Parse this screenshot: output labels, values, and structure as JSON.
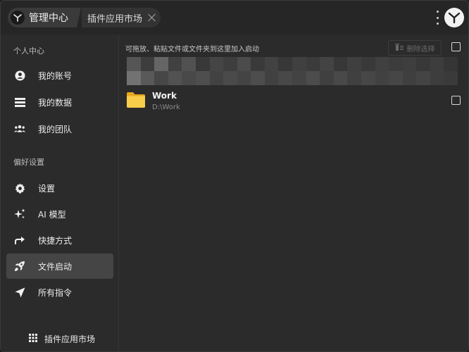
{
  "titlebar": {
    "home_label": "管理中心",
    "current_tab": "插件应用市场"
  },
  "sidebar": {
    "section_personal": "个人中心",
    "section_prefs": "偏好设置",
    "items": [
      {
        "label": "我的账号",
        "icon": "user-circle-icon"
      },
      {
        "label": "我的数据",
        "icon": "data-list-icon"
      },
      {
        "label": "我的团队",
        "icon": "team-icon"
      },
      {
        "label": "设置",
        "icon": "gear-icon"
      },
      {
        "label": "AI 模型",
        "icon": "sparkle-icon"
      },
      {
        "label": "快捷方式",
        "icon": "share-arrow-icon"
      },
      {
        "label": "文件启动",
        "icon": "rocket-icon",
        "active": true
      },
      {
        "label": "所有指令",
        "icon": "send-arrow-icon"
      }
    ],
    "market_label": "插件应用市场"
  },
  "main": {
    "hint": "可拖放、粘贴文件或文件夹到这里加入启动",
    "delete_label": "删除选择",
    "files": [
      {
        "name": "Work",
        "path": "D:\\Work",
        "icon": "folder-icon"
      }
    ]
  },
  "colors": {
    "background": "#2b2b2b",
    "active_item": "#454545",
    "folder": "#f5c342"
  }
}
